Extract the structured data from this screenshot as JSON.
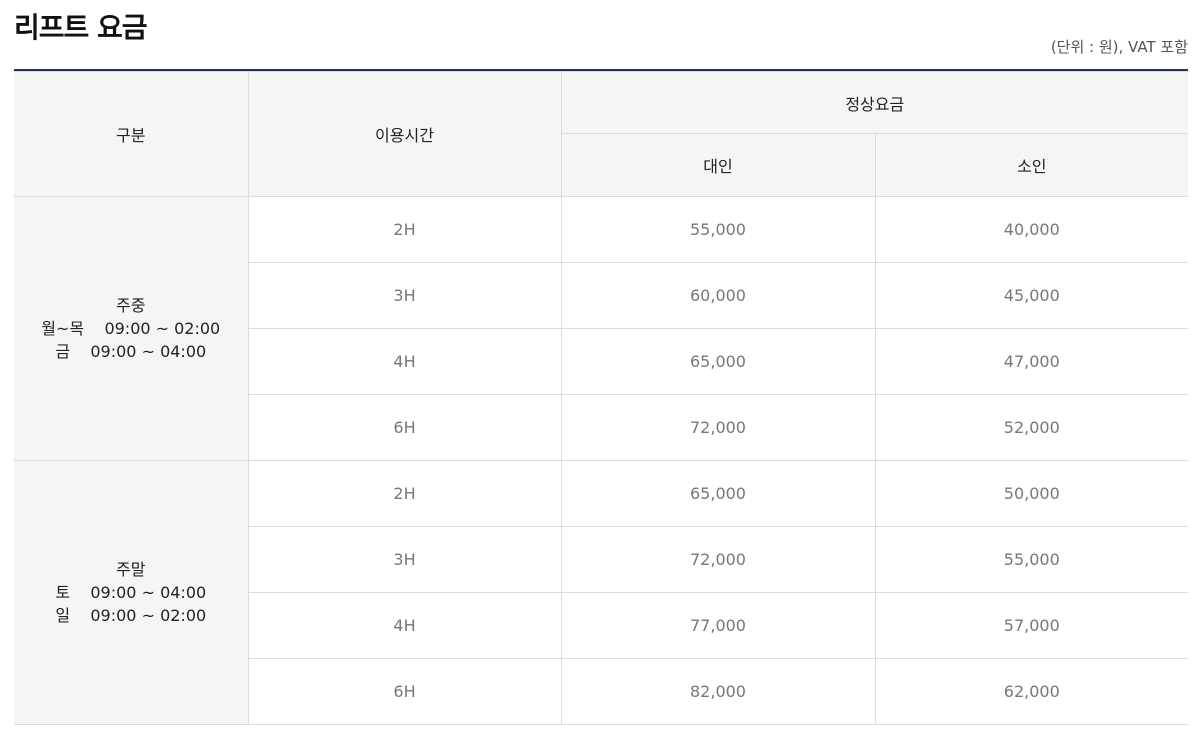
{
  "title": "리프트 요금",
  "unit_note": "(단위 : 원), VAT 포함",
  "headers": {
    "category": "구분",
    "duration": "이용시간",
    "regular": "정상요금",
    "adult": "대인",
    "child": "소인"
  },
  "groups": [
    {
      "name": "주중",
      "hours": [
        "월~목    09:00 ~ 02:00",
        "금    09:00 ~ 04:00"
      ],
      "rows": [
        {
          "duration": "2H",
          "adult": "55,000",
          "child": "40,000"
        },
        {
          "duration": "3H",
          "adult": "60,000",
          "child": "45,000"
        },
        {
          "duration": "4H",
          "adult": "65,000",
          "child": "47,000"
        },
        {
          "duration": "6H",
          "adult": "72,000",
          "child": "52,000"
        }
      ]
    },
    {
      "name": "주말",
      "hours": [
        "토    09:00 ~ 04:00",
        "일    09:00 ~ 02:00"
      ],
      "rows": [
        {
          "duration": "2H",
          "adult": "65,000",
          "child": "50,000"
        },
        {
          "duration": "3H",
          "adult": "72,000",
          "child": "55,000"
        },
        {
          "duration": "4H",
          "adult": "77,000",
          "child": "57,000"
        },
        {
          "duration": "6H",
          "adult": "82,000",
          "child": "62,000"
        }
      ]
    }
  ]
}
